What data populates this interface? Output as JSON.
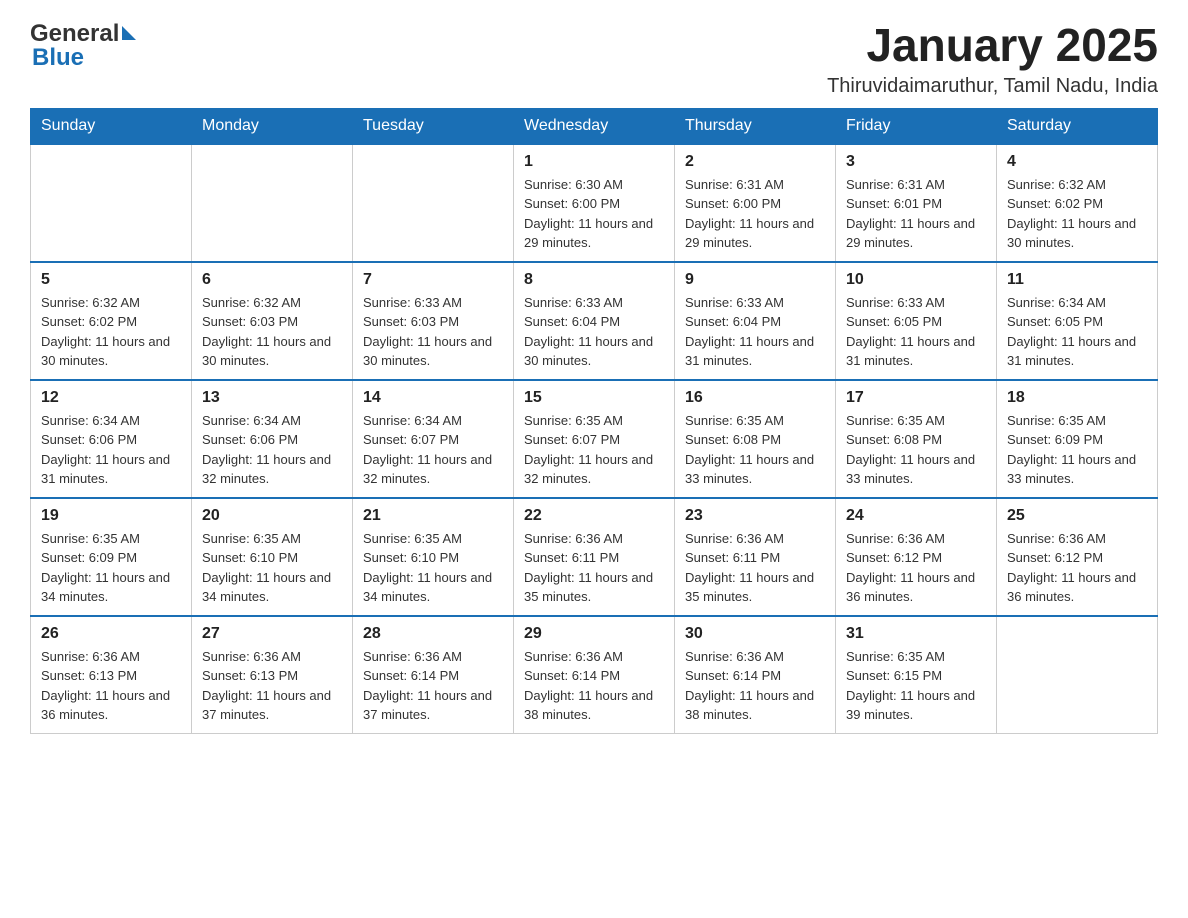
{
  "header": {
    "logo_general": "General",
    "logo_blue": "Blue",
    "main_title": "January 2025",
    "subtitle": "Thiruvidaimaruthur, Tamil Nadu, India"
  },
  "calendar": {
    "days_of_week": [
      "Sunday",
      "Monday",
      "Tuesday",
      "Wednesday",
      "Thursday",
      "Friday",
      "Saturday"
    ],
    "weeks": [
      [
        {
          "day": "",
          "info": ""
        },
        {
          "day": "",
          "info": ""
        },
        {
          "day": "",
          "info": ""
        },
        {
          "day": "1",
          "info": "Sunrise: 6:30 AM\nSunset: 6:00 PM\nDaylight: 11 hours and 29 minutes."
        },
        {
          "day": "2",
          "info": "Sunrise: 6:31 AM\nSunset: 6:00 PM\nDaylight: 11 hours and 29 minutes."
        },
        {
          "day": "3",
          "info": "Sunrise: 6:31 AM\nSunset: 6:01 PM\nDaylight: 11 hours and 29 minutes."
        },
        {
          "day": "4",
          "info": "Sunrise: 6:32 AM\nSunset: 6:02 PM\nDaylight: 11 hours and 30 minutes."
        }
      ],
      [
        {
          "day": "5",
          "info": "Sunrise: 6:32 AM\nSunset: 6:02 PM\nDaylight: 11 hours and 30 minutes."
        },
        {
          "day": "6",
          "info": "Sunrise: 6:32 AM\nSunset: 6:03 PM\nDaylight: 11 hours and 30 minutes."
        },
        {
          "day": "7",
          "info": "Sunrise: 6:33 AM\nSunset: 6:03 PM\nDaylight: 11 hours and 30 minutes."
        },
        {
          "day": "8",
          "info": "Sunrise: 6:33 AM\nSunset: 6:04 PM\nDaylight: 11 hours and 30 minutes."
        },
        {
          "day": "9",
          "info": "Sunrise: 6:33 AM\nSunset: 6:04 PM\nDaylight: 11 hours and 31 minutes."
        },
        {
          "day": "10",
          "info": "Sunrise: 6:33 AM\nSunset: 6:05 PM\nDaylight: 11 hours and 31 minutes."
        },
        {
          "day": "11",
          "info": "Sunrise: 6:34 AM\nSunset: 6:05 PM\nDaylight: 11 hours and 31 minutes."
        }
      ],
      [
        {
          "day": "12",
          "info": "Sunrise: 6:34 AM\nSunset: 6:06 PM\nDaylight: 11 hours and 31 minutes."
        },
        {
          "day": "13",
          "info": "Sunrise: 6:34 AM\nSunset: 6:06 PM\nDaylight: 11 hours and 32 minutes."
        },
        {
          "day": "14",
          "info": "Sunrise: 6:34 AM\nSunset: 6:07 PM\nDaylight: 11 hours and 32 minutes."
        },
        {
          "day": "15",
          "info": "Sunrise: 6:35 AM\nSunset: 6:07 PM\nDaylight: 11 hours and 32 minutes."
        },
        {
          "day": "16",
          "info": "Sunrise: 6:35 AM\nSunset: 6:08 PM\nDaylight: 11 hours and 33 minutes."
        },
        {
          "day": "17",
          "info": "Sunrise: 6:35 AM\nSunset: 6:08 PM\nDaylight: 11 hours and 33 minutes."
        },
        {
          "day": "18",
          "info": "Sunrise: 6:35 AM\nSunset: 6:09 PM\nDaylight: 11 hours and 33 minutes."
        }
      ],
      [
        {
          "day": "19",
          "info": "Sunrise: 6:35 AM\nSunset: 6:09 PM\nDaylight: 11 hours and 34 minutes."
        },
        {
          "day": "20",
          "info": "Sunrise: 6:35 AM\nSunset: 6:10 PM\nDaylight: 11 hours and 34 minutes."
        },
        {
          "day": "21",
          "info": "Sunrise: 6:35 AM\nSunset: 6:10 PM\nDaylight: 11 hours and 34 minutes."
        },
        {
          "day": "22",
          "info": "Sunrise: 6:36 AM\nSunset: 6:11 PM\nDaylight: 11 hours and 35 minutes."
        },
        {
          "day": "23",
          "info": "Sunrise: 6:36 AM\nSunset: 6:11 PM\nDaylight: 11 hours and 35 minutes."
        },
        {
          "day": "24",
          "info": "Sunrise: 6:36 AM\nSunset: 6:12 PM\nDaylight: 11 hours and 36 minutes."
        },
        {
          "day": "25",
          "info": "Sunrise: 6:36 AM\nSunset: 6:12 PM\nDaylight: 11 hours and 36 minutes."
        }
      ],
      [
        {
          "day": "26",
          "info": "Sunrise: 6:36 AM\nSunset: 6:13 PM\nDaylight: 11 hours and 36 minutes."
        },
        {
          "day": "27",
          "info": "Sunrise: 6:36 AM\nSunset: 6:13 PM\nDaylight: 11 hours and 37 minutes."
        },
        {
          "day": "28",
          "info": "Sunrise: 6:36 AM\nSunset: 6:14 PM\nDaylight: 11 hours and 37 minutes."
        },
        {
          "day": "29",
          "info": "Sunrise: 6:36 AM\nSunset: 6:14 PM\nDaylight: 11 hours and 38 minutes."
        },
        {
          "day": "30",
          "info": "Sunrise: 6:36 AM\nSunset: 6:14 PM\nDaylight: 11 hours and 38 minutes."
        },
        {
          "day": "31",
          "info": "Sunrise: 6:35 AM\nSunset: 6:15 PM\nDaylight: 11 hours and 39 minutes."
        },
        {
          "day": "",
          "info": ""
        }
      ]
    ]
  }
}
